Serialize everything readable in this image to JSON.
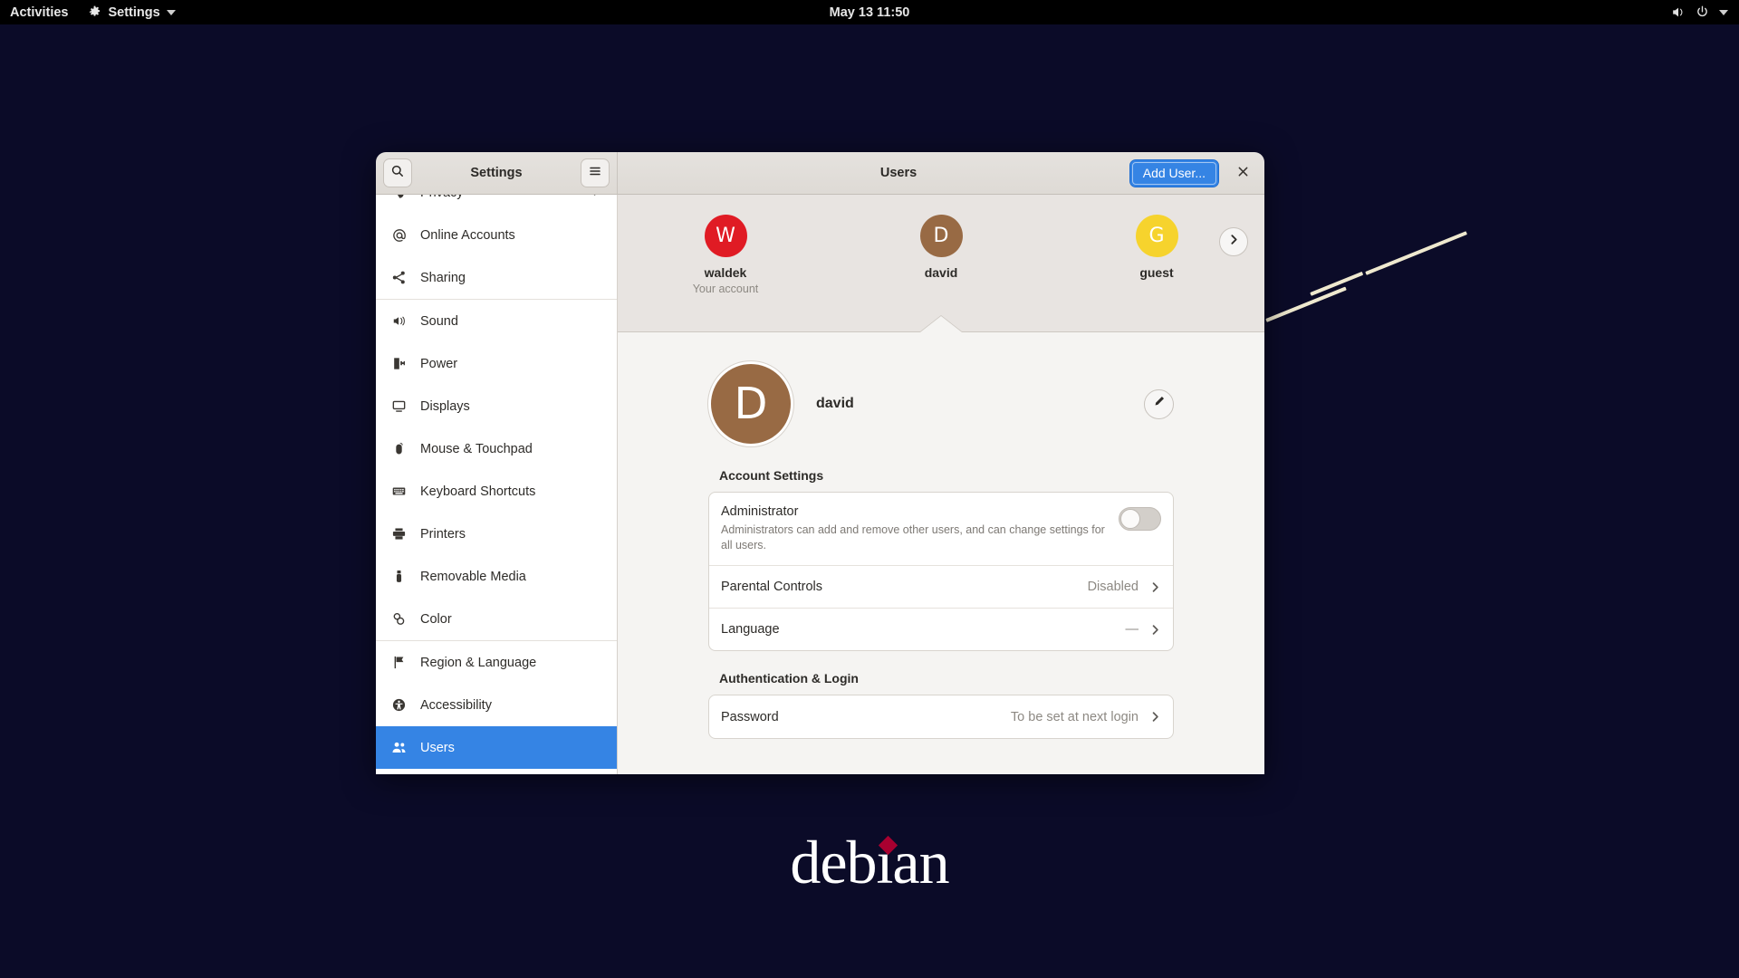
{
  "topbar": {
    "activities": "Activities",
    "app_menu": "Settings",
    "app_icon": "gear-icon",
    "clock": "May 13  11:50",
    "volume_icon": "speaker-icon",
    "power_icon": "power-icon",
    "menu_caret": "chevron-down-icon"
  },
  "desktop": {
    "logo_text": "debian",
    "background_color": "#0b0b28",
    "accent_line_color": "#efe9cf",
    "logo_dot_color": "#a80030"
  },
  "window": {
    "sidebar_title": "Settings",
    "page_title": "Users",
    "search_icon": "search-icon",
    "menu_icon": "hamburger-icon",
    "add_user_label": "Add User...",
    "close_label": "×"
  },
  "sidebar": {
    "items": [
      {
        "label": "Privacy",
        "icon": "hand-icon",
        "chevron": true,
        "selected": false,
        "sep_after": false
      },
      {
        "label": "Online Accounts",
        "icon": "at-icon",
        "chevron": false,
        "selected": false,
        "sep_after": false
      },
      {
        "label": "Sharing",
        "icon": "share-icon",
        "chevron": false,
        "selected": false,
        "sep_after": true
      },
      {
        "label": "Sound",
        "icon": "speaker-icon",
        "chevron": false,
        "selected": false,
        "sep_after": false
      },
      {
        "label": "Power",
        "icon": "power-plug-icon",
        "chevron": false,
        "selected": false,
        "sep_after": false
      },
      {
        "label": "Displays",
        "icon": "monitor-icon",
        "chevron": false,
        "selected": false,
        "sep_after": false
      },
      {
        "label": "Mouse & Touchpad",
        "icon": "mouse-icon",
        "chevron": false,
        "selected": false,
        "sep_after": false
      },
      {
        "label": "Keyboard Shortcuts",
        "icon": "keyboard-icon",
        "chevron": false,
        "selected": false,
        "sep_after": false
      },
      {
        "label": "Printers",
        "icon": "printer-icon",
        "chevron": false,
        "selected": false,
        "sep_after": false
      },
      {
        "label": "Removable Media",
        "icon": "usb-icon",
        "chevron": false,
        "selected": false,
        "sep_after": false
      },
      {
        "label": "Color",
        "icon": "color-icon",
        "chevron": false,
        "selected": false,
        "sep_after": true
      },
      {
        "label": "Region & Language",
        "icon": "flag-icon",
        "chevron": false,
        "selected": false,
        "sep_after": false
      },
      {
        "label": "Accessibility",
        "icon": "accessibility-icon",
        "chevron": false,
        "selected": false,
        "sep_after": false
      },
      {
        "label": "Users",
        "icon": "users-icon",
        "chevron": false,
        "selected": true,
        "sep_after": false
      }
    ]
  },
  "users_carousel": {
    "next_icon": "chevron-right-icon",
    "users": [
      {
        "name": "waldek",
        "initial": "W",
        "color": "#e01b24",
        "subtitle": "Your account",
        "selected": false
      },
      {
        "name": "david",
        "initial": "D",
        "color": "#986a44",
        "subtitle": "",
        "selected": true
      },
      {
        "name": "guest",
        "initial": "G",
        "color": "#f6d32d",
        "subtitle": "",
        "selected": false
      }
    ]
  },
  "detail": {
    "username": "david",
    "initial": "D",
    "avatar_color": "#986a44",
    "edit_icon": "pencil-icon",
    "sections": [
      {
        "title": "Account Settings",
        "rows": [
          {
            "label": "Administrator",
            "description": "Administrators can add and remove other users, and can change settings for all users.",
            "control": "toggle",
            "value": "off"
          },
          {
            "label": "Parental Controls",
            "value": "Disabled",
            "control": "chevron"
          },
          {
            "label": "Language",
            "value": "—",
            "control": "chevron"
          }
        ]
      },
      {
        "title": "Authentication & Login",
        "rows": [
          {
            "label": "Password",
            "value": "To be set at next login",
            "control": "chevron"
          }
        ]
      }
    ]
  }
}
